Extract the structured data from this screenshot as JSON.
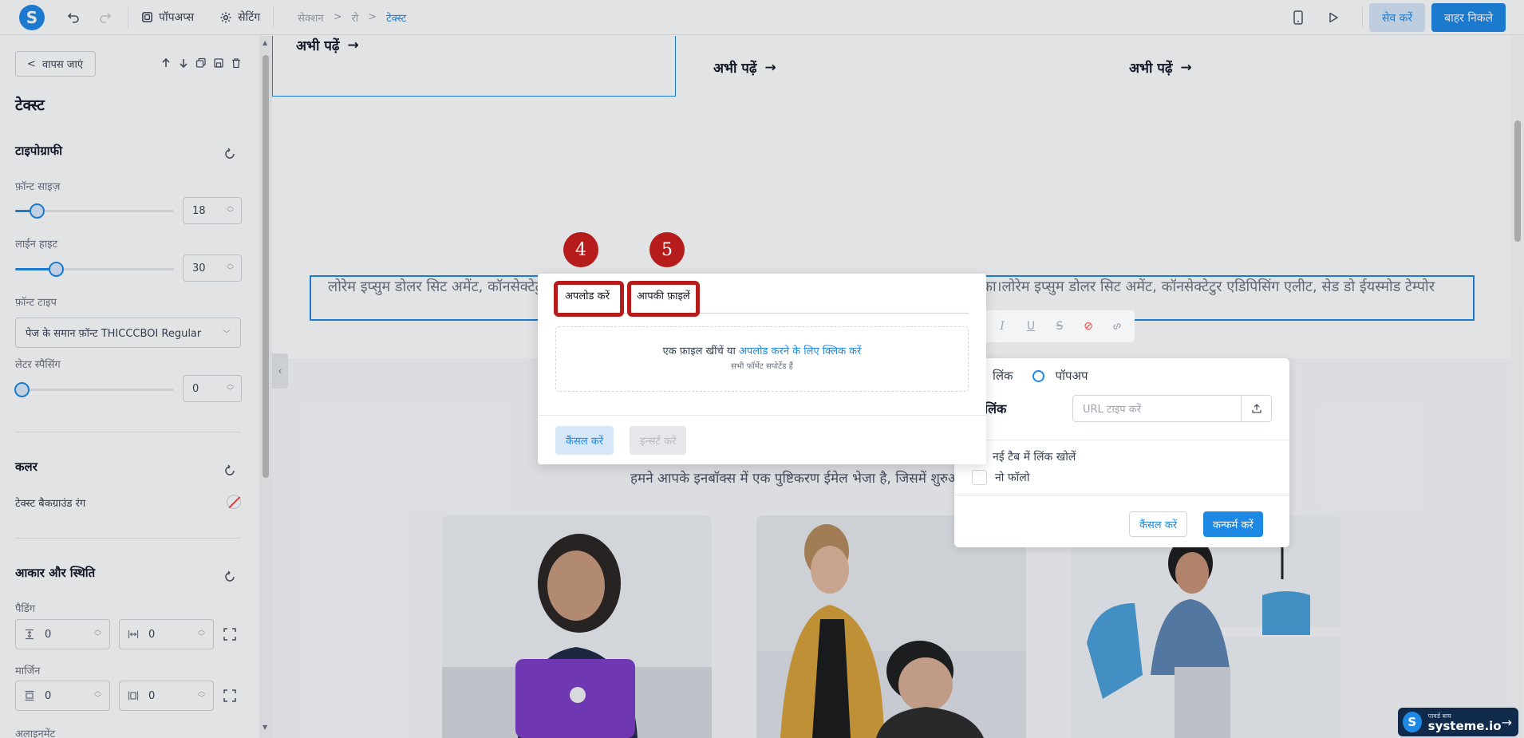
{
  "topbar": {
    "logo": "S",
    "undo_icon": "undo-icon",
    "redo_icon": "redo-icon",
    "popups_label": "पॉपअप्स",
    "settings_label": "सेटिंग",
    "breadcrumb": [
      "सेक्शन",
      "रो",
      "टेक्स्ट"
    ],
    "save_label": "सेव करें",
    "exit_label": "बाहर निकले"
  },
  "sidebar": {
    "back_label": "वापस जाएं",
    "title": "टेक्स्ट",
    "typography_title": "टाइपोग्राफी",
    "font_size_label": "फ़ॉन्ट साइज़",
    "font_size_value": "18",
    "line_height_label": "लाईन हाइट",
    "line_height_value": "30",
    "font_type_label": "फ़ॉन्ट टाइप",
    "font_type_value": "पेज के समान फ़ॉन्ट THICCCBOI Regular",
    "letter_spacing_label": "लेटर स्पैसिंग",
    "letter_spacing_value": "0",
    "color_title": "कलर",
    "text_bg_label": "टेक्स्ट बैकग्राउंड रंग",
    "size_position_title": "आकार और स्थिति",
    "padding_label": "पैडिंग",
    "padding_vertical": "0",
    "padding_horizontal": "0",
    "margin_label": "मार्जिन",
    "margin_vertical": "0",
    "margin_horizontal": "0",
    "alignment_label": "अलाइनमेंट"
  },
  "canvas": {
    "read_more": "अभी पढ़ें",
    "lorem": "लोरेम इप्सुम डोलर सिट अमेंट, कॉनसेक्टेटुर एडिपिसिंग एलीट, सेड डो ईयस्मोड टेम्पोर इन्सिडिडुंट उट लेबोरे एट डोलोरे मैग्ना अलीका।लोरेम इप्सुम डोलर सिट अमेंट, कॉनसेक्टेटुर एडिपिसिंग एलीट, सेड डो ईयस्मोड टेम्पोर",
    "confirmation": "हमने आपके इनबॉक्स में एक पुष्टिकरण ईमेल भेजा है, जिसमें शुरुआत करने का लिंक है।"
  },
  "link_popover": {
    "link_option": "लिंक",
    "popup_option": "पॉपअप",
    "url_label": "लिंक",
    "url_placeholder": "URL टाइप करें",
    "new_tab_label": "नई टैब में लिंक खोलें",
    "nofollow_label": "नो फॉलो",
    "cancel_label": "कैंसल करें",
    "confirm_label": "कन्फर्म करें"
  },
  "file_modal": {
    "tab_upload": "अपलोड करें",
    "tab_files": "आपकी फ़ाइलें",
    "drop_text": "एक फ़ाइल खींचें या ",
    "drop_link": "अपलोड करने के लिए क्लिक करें",
    "formats_text": "सभी फॉर्मेट सपोर्टेड हैं",
    "cancel_label": "कैंसल करें",
    "insert_label": "इन्सर्ट करें"
  },
  "annotations": {
    "badge_4": "4",
    "badge_5": "5"
  },
  "footer": {
    "powered_by": "पावर्ड बाय",
    "brand": "systeme.io"
  },
  "colors": {
    "accent": "#1e88e5",
    "annotation": "#b71c1c"
  }
}
